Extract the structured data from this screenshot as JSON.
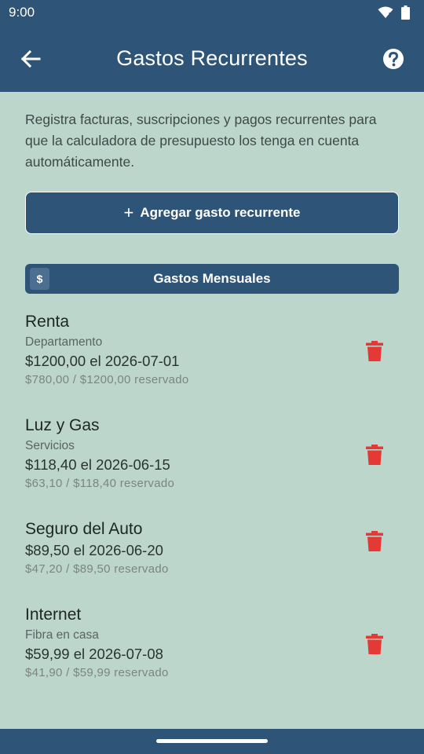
{
  "status_bar": {
    "time": "9:00"
  },
  "app_bar": {
    "title": "Gastos Recurrentes"
  },
  "intro_text": "Registra facturas, suscripciones y pagos recurrentes para que la calculadora de presupuesto los tenga en cuenta automáticamente.",
  "add_button": {
    "plus": "+",
    "label": "Agregar gasto recurrente"
  },
  "section": {
    "badge": "$",
    "title": "Gastos Mensuales"
  },
  "expenses": [
    {
      "name": "Renta",
      "category": "Departamento",
      "amount": "$1200,00 el 2026-07-01",
      "reserved": "$780,00 / $1200,00 reservado"
    },
    {
      "name": "Luz y Gas",
      "category": "Servicios",
      "amount": "$118,40 el 2026-06-15",
      "reserved": "$63,10 / $118,40 reservado"
    },
    {
      "name": "Seguro del Auto",
      "category": "",
      "amount": "$89,50 el 2026-06-20",
      "reserved": "$47,20 / $89,50 reservado"
    },
    {
      "name": "Internet",
      "category": "Fibra en casa",
      "amount": "$59,99 el 2026-07-08",
      "reserved": "$41,90 / $59,99 reservado"
    }
  ],
  "colors": {
    "primary": "#2e5478",
    "background": "#bcd6cc",
    "delete": "#e53935"
  },
  "icons": {
    "back": "arrow-left-icon",
    "help": "help-circle-icon",
    "delete": "trash-icon"
  }
}
